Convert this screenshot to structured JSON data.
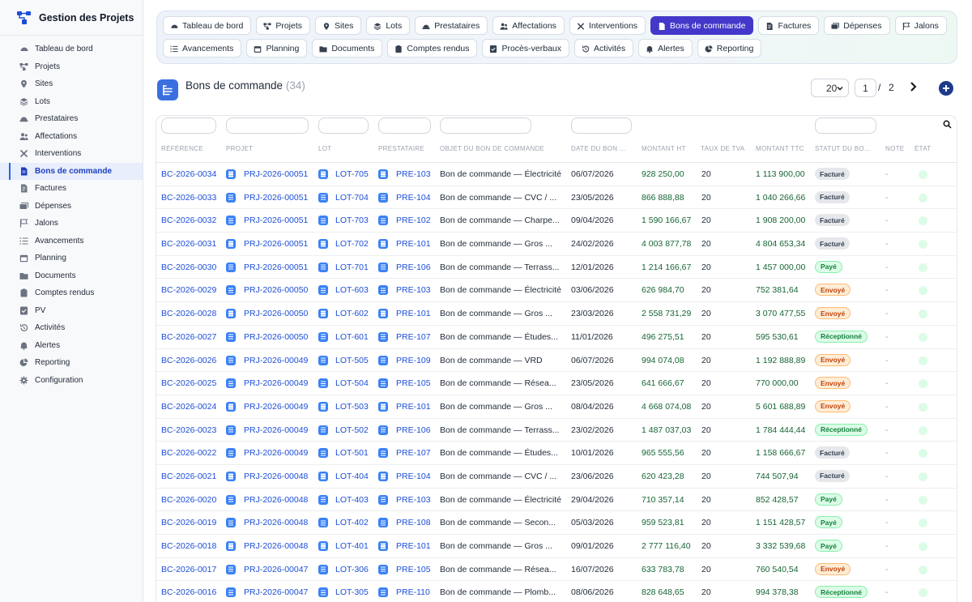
{
  "app": {
    "title": "Gestion des Projets"
  },
  "sidebar": {
    "items": [
      {
        "label": "Tableau de bord",
        "icon": "dashboard-icon"
      },
      {
        "label": "Projets",
        "icon": "projects-icon"
      },
      {
        "label": "Sites",
        "icon": "pin-icon"
      },
      {
        "label": "Lots",
        "icon": "layers-icon"
      },
      {
        "label": "Prestataires",
        "icon": "worker-icon"
      },
      {
        "label": "Affectations",
        "icon": "users-icon"
      },
      {
        "label": "Interventions",
        "icon": "tools-icon"
      },
      {
        "label": "Bons de commande",
        "icon": "document-icon",
        "active": true
      },
      {
        "label": "Factures",
        "icon": "invoice-icon"
      },
      {
        "label": "Dépenses",
        "icon": "money-icon"
      },
      {
        "label": "Jalons",
        "icon": "flag-icon"
      },
      {
        "label": "Avancements",
        "icon": "list-icon"
      },
      {
        "label": "Planning",
        "icon": "calendar-icon"
      },
      {
        "label": "Documents",
        "icon": "folder-icon"
      },
      {
        "label": "Comptes rendus",
        "icon": "clipboard-icon"
      },
      {
        "label": "PV",
        "icon": "check-file-icon"
      },
      {
        "label": "Activités",
        "icon": "history-icon"
      },
      {
        "label": "Alertes",
        "icon": "bell-icon"
      },
      {
        "label": "Reporting",
        "icon": "pie-chart-icon"
      },
      {
        "label": "Configuration",
        "icon": "gear-icon"
      }
    ]
  },
  "tabs": {
    "row1": [
      {
        "label": "Tableau de bord",
        "icon": "dashboard-icon"
      },
      {
        "label": "Projets",
        "icon": "projects-icon"
      },
      {
        "label": "Sites",
        "icon": "pin-icon"
      },
      {
        "label": "Lots",
        "icon": "layers-icon"
      },
      {
        "label": "Prestataires",
        "icon": "worker-icon"
      },
      {
        "label": "Affectations",
        "icon": "users-icon"
      },
      {
        "label": "Interventions",
        "icon": "tools-icon"
      },
      {
        "label": "Bons de commande",
        "icon": "document-icon",
        "active": true
      },
      {
        "label": "Factures",
        "icon": "invoice-icon"
      },
      {
        "label": "Dépenses",
        "icon": "money-icon"
      },
      {
        "label": "Jalons",
        "icon": "flag-icon"
      }
    ],
    "row2": [
      {
        "label": "Avancements",
        "icon": "list-icon"
      },
      {
        "label": "Planning",
        "icon": "calendar-icon"
      },
      {
        "label": "Documents",
        "icon": "folder-icon"
      },
      {
        "label": "Comptes rendus",
        "icon": "clipboard-icon"
      },
      {
        "label": "Procès-verbaux",
        "icon": "check-file-icon"
      },
      {
        "label": "Activités",
        "icon": "history-icon"
      },
      {
        "label": "Alertes",
        "icon": "bell-icon"
      },
      {
        "label": "Reporting",
        "icon": "pie-chart-icon"
      }
    ]
  },
  "page": {
    "title": "Bons de commande",
    "count": "(34)"
  },
  "pager": {
    "page_size": "20",
    "current": "1",
    "separator": "/",
    "total": "2"
  },
  "table": {
    "columns": [
      "RÉFÉRENCE",
      "PROJET",
      "LOT",
      "PRESTATAIRE",
      "OBJET DU BON DE COMMANDE",
      "DATE DU BON ...",
      "MONTANT HT",
      "TAUX DE TVA",
      "MONTANT TTC",
      "STATUT DU BO...",
      "NOTE",
      "ÉTAT"
    ],
    "rows": [
      {
        "ref": "BC-2026-0034",
        "projet": "PRJ-2026-00051",
        "lot": "LOT-705",
        "prest": "PRE-103",
        "objet": "Bon de commande — Électricité",
        "date": "06/07/2026",
        "ht": "928 250,00",
        "tva": "20",
        "ttc": "1 113 900,00",
        "statut": "Facturé",
        "note": "-"
      },
      {
        "ref": "BC-2026-0033",
        "projet": "PRJ-2026-00051",
        "lot": "LOT-704",
        "prest": "PRE-104",
        "objet": "Bon de commande — CVC / ...",
        "date": "23/05/2026",
        "ht": "866 888,88",
        "tva": "20",
        "ttc": "1 040 266,66",
        "statut": "Facturé",
        "note": "-"
      },
      {
        "ref": "BC-2026-0032",
        "projet": "PRJ-2026-00051",
        "lot": "LOT-703",
        "prest": "PRE-102",
        "objet": "Bon de commande — Charpe...",
        "date": "09/04/2026",
        "ht": "1 590 166,67",
        "tva": "20",
        "ttc": "1 908 200,00",
        "statut": "Facturé",
        "note": "-"
      },
      {
        "ref": "BC-2026-0031",
        "projet": "PRJ-2026-00051",
        "lot": "LOT-702",
        "prest": "PRE-101",
        "objet": "Bon de commande — Gros ...",
        "date": "24/02/2026",
        "ht": "4 003 877,78",
        "tva": "20",
        "ttc": "4 804 653,34",
        "statut": "Facturé",
        "note": "-"
      },
      {
        "ref": "BC-2026-0030",
        "projet": "PRJ-2026-00051",
        "lot": "LOT-701",
        "prest": "PRE-106",
        "objet": "Bon de commande — Terrass...",
        "date": "12/01/2026",
        "ht": "1 214 166,67",
        "tva": "20",
        "ttc": "1 457 000,00",
        "statut": "Payé",
        "note": "-"
      },
      {
        "ref": "BC-2026-0029",
        "projet": "PRJ-2026-00050",
        "lot": "LOT-603",
        "prest": "PRE-103",
        "objet": "Bon de commande — Électricité",
        "date": "03/06/2026",
        "ht": "626 984,70",
        "tva": "20",
        "ttc": "752 381,64",
        "statut": "Envoyé",
        "note": "-"
      },
      {
        "ref": "BC-2026-0028",
        "projet": "PRJ-2026-00050",
        "lot": "LOT-602",
        "prest": "PRE-101",
        "objet": "Bon de commande — Gros ...",
        "date": "23/03/2026",
        "ht": "2 558 731,29",
        "tva": "20",
        "ttc": "3 070 477,55",
        "statut": "Envoyé",
        "note": "-"
      },
      {
        "ref": "BC-2026-0027",
        "projet": "PRJ-2026-00050",
        "lot": "LOT-601",
        "prest": "PRE-107",
        "objet": "Bon de commande — Études...",
        "date": "11/01/2026",
        "ht": "496 275,51",
        "tva": "20",
        "ttc": "595 530,61",
        "statut": "Réceptionné",
        "note": "-"
      },
      {
        "ref": "BC-2026-0026",
        "projet": "PRJ-2026-00049",
        "lot": "LOT-505",
        "prest": "PRE-109",
        "objet": "Bon de commande — VRD",
        "date": "06/07/2026",
        "ht": "994 074,08",
        "tva": "20",
        "ttc": "1 192 888,89",
        "statut": "Envoyé",
        "note": "-"
      },
      {
        "ref": "BC-2026-0025",
        "projet": "PRJ-2026-00049",
        "lot": "LOT-504",
        "prest": "PRE-105",
        "objet": "Bon de commande — Résea...",
        "date": "23/05/2026",
        "ht": "641 666,67",
        "tva": "20",
        "ttc": "770 000,00",
        "statut": "Envoyé",
        "note": "-"
      },
      {
        "ref": "BC-2026-0024",
        "projet": "PRJ-2026-00049",
        "lot": "LOT-503",
        "prest": "PRE-101",
        "objet": "Bon de commande — Gros ...",
        "date": "08/04/2026",
        "ht": "4 668 074,08",
        "tva": "20",
        "ttc": "5 601 688,89",
        "statut": "Envoyé",
        "note": "-"
      },
      {
        "ref": "BC-2026-0023",
        "projet": "PRJ-2026-00049",
        "lot": "LOT-502",
        "prest": "PRE-106",
        "objet": "Bon de commande — Terrass...",
        "date": "23/02/2026",
        "ht": "1 487 037,03",
        "tva": "20",
        "ttc": "1 784 444,44",
        "statut": "Réceptionné",
        "note": "-"
      },
      {
        "ref": "BC-2026-0022",
        "projet": "PRJ-2026-00049",
        "lot": "LOT-501",
        "prest": "PRE-107",
        "objet": "Bon de commande — Études...",
        "date": "10/01/2026",
        "ht": "965 555,56",
        "tva": "20",
        "ttc": "1 158 666,67",
        "statut": "Facturé",
        "note": "-"
      },
      {
        "ref": "BC-2026-0021",
        "projet": "PRJ-2026-00048",
        "lot": "LOT-404",
        "prest": "PRE-104",
        "objet": "Bon de commande — CVC / ...",
        "date": "23/06/2026",
        "ht": "620 423,28",
        "tva": "20",
        "ttc": "744 507,94",
        "statut": "Facturé",
        "note": "-"
      },
      {
        "ref": "BC-2026-0020",
        "projet": "PRJ-2026-00048",
        "lot": "LOT-403",
        "prest": "PRE-103",
        "objet": "Bon de commande — Électricité",
        "date": "29/04/2026",
        "ht": "710 357,14",
        "tva": "20",
        "ttc": "852 428,57",
        "statut": "Payé",
        "note": "-"
      },
      {
        "ref": "BC-2026-0019",
        "projet": "PRJ-2026-00048",
        "lot": "LOT-402",
        "prest": "PRE-108",
        "objet": "Bon de commande — Secon...",
        "date": "05/03/2026",
        "ht": "959 523,81",
        "tva": "20",
        "ttc": "1 151 428,57",
        "statut": "Payé",
        "note": "-"
      },
      {
        "ref": "BC-2026-0018",
        "projet": "PRJ-2026-00048",
        "lot": "LOT-401",
        "prest": "PRE-101",
        "objet": "Bon de commande — Gros ...",
        "date": "09/01/2026",
        "ht": "2 777 116,40",
        "tva": "20",
        "ttc": "3 332 539,68",
        "statut": "Payé",
        "note": "-"
      },
      {
        "ref": "BC-2026-0017",
        "projet": "PRJ-2026-00047",
        "lot": "LOT-306",
        "prest": "PRE-105",
        "objet": "Bon de commande — Résea...",
        "date": "16/07/2026",
        "ht": "633 783,78",
        "tva": "20",
        "ttc": "760 540,54",
        "statut": "Envoyé",
        "note": "-"
      },
      {
        "ref": "BC-2026-0016",
        "projet": "PRJ-2026-00047",
        "lot": "LOT-305",
        "prest": "PRE-110",
        "objet": "Bon de commande — Plomb...",
        "date": "08/06/2026",
        "ht": "828 648,65",
        "tva": "20",
        "ttc": "994 378,38",
        "statut": "Réceptionné",
        "note": "-"
      }
    ]
  }
}
